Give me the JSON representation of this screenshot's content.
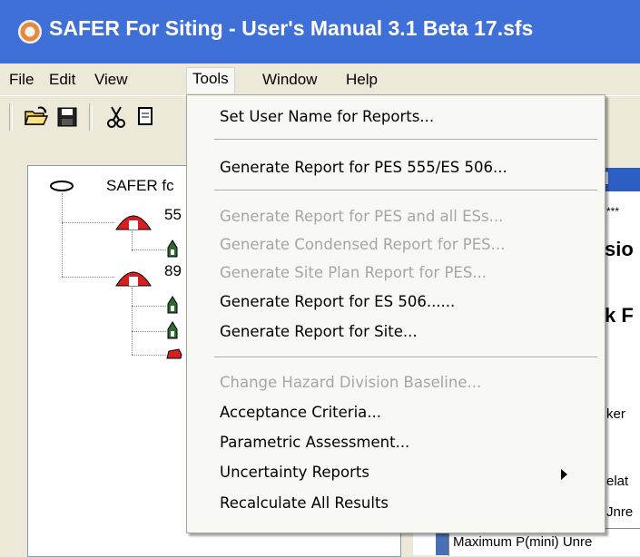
{
  "window": {
    "title": "SAFER For Siting - User's Manual 3.1 Beta 17.sfs"
  },
  "menubar": {
    "items": [
      "File",
      "Edit",
      "View",
      "Tools",
      "Window",
      "Help"
    ]
  },
  "toolbar": {
    "buttons": [
      "open-icon",
      "save-icon",
      "cut-icon",
      "copy-icon"
    ]
  },
  "tree": {
    "root_label": "SAFER fc",
    "nodes": [
      "55",
      "89"
    ]
  },
  "tools_menu": {
    "items": [
      {
        "label": "Set User Name for Reports...",
        "enabled": true
      },
      {
        "label": "Generate Report for PES 555/ES 506...",
        "enabled": true
      },
      {
        "label": "Generate Report for PES and all ESs...",
        "enabled": false
      },
      {
        "label": "Generate Condensed Report for PES...",
        "enabled": false
      },
      {
        "label": "Generate Site Plan Report for PES...",
        "enabled": false
      },
      {
        "label": "Generate Report for ES 506......",
        "enabled": true
      },
      {
        "label": "Generate Report for Site...",
        "enabled": true
      },
      {
        "label": "Change Hazard Division Baseline...",
        "enabled": false
      },
      {
        "label": "Acceptance Criteria...",
        "enabled": true
      },
      {
        "label": "Parametric Assessment...",
        "enabled": true
      },
      {
        "label": "Uncertainty Reports",
        "enabled": true,
        "submenu": true
      },
      {
        "label": "Recalculate All Results",
        "enabled": true
      }
    ]
  },
  "document": {
    "title_fragment": "ul",
    "stars": "***",
    "heading1": "sio",
    "heading2": "k F",
    "text1": "ker",
    "text2": "elat",
    "text3": "Jnre",
    "bottom_row": "Maximum P(mini) Unre"
  },
  "colors": {
    "titlebar": "#3f70d8",
    "menu_bg": "#f8f8f4",
    "disabled": "#a7a6a2"
  }
}
